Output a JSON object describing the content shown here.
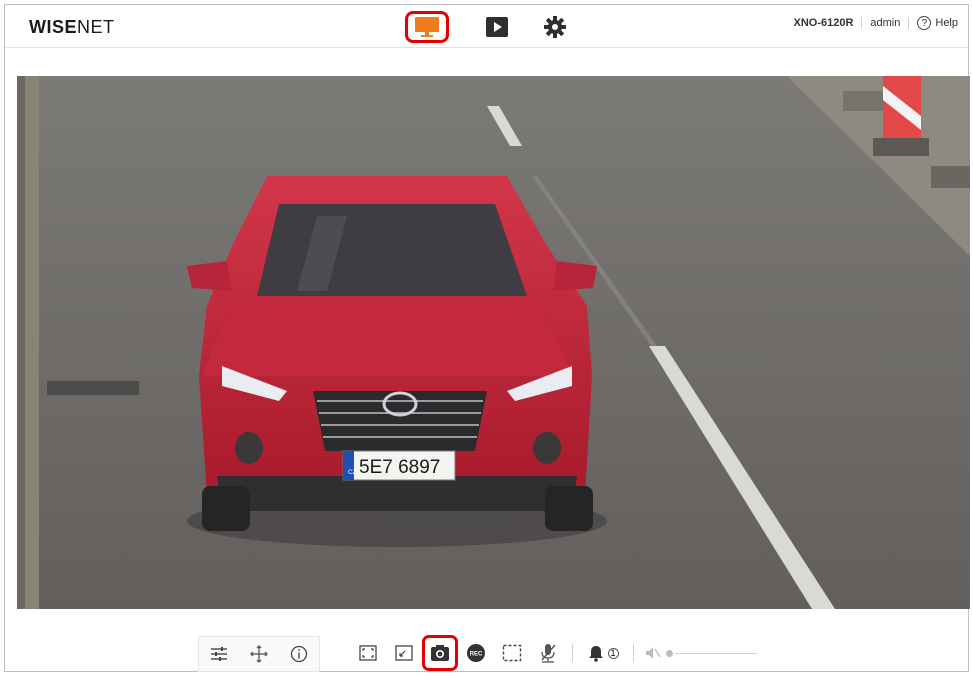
{
  "header": {
    "logo_bold": "WISE",
    "logo_thin": "NET",
    "model": "XNO-6120R",
    "user": "admin",
    "help_label": "Help"
  },
  "nav": {
    "active": "live",
    "items": [
      "live",
      "playback",
      "setup"
    ]
  },
  "video": {
    "plate_text": "5E7 6897",
    "plate_prefix": "CZ"
  },
  "toolbar": {
    "alarm_count": "1",
    "active_tool": "snapshot"
  },
  "colors": {
    "accent": "#f07b1e",
    "highlight": "#e50000",
    "car": "#c8233a"
  }
}
